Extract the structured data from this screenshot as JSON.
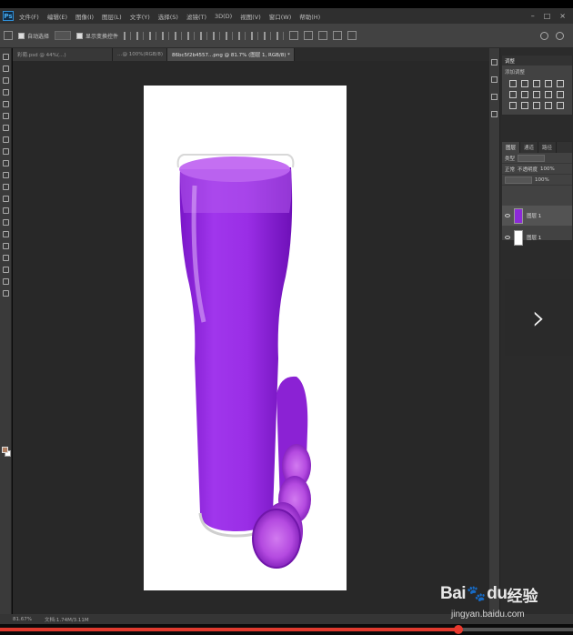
{
  "app": {
    "logo_text": "Ps"
  },
  "menu": {
    "items": [
      "文件(F)",
      "编辑(E)",
      "图像(I)",
      "图层(L)",
      "文字(Y)",
      "选择(S)",
      "滤镜(T)",
      "3D(D)",
      "视图(V)",
      "窗口(W)",
      "帮助(H)"
    ]
  },
  "options": {
    "auto_select_label": "自动选择",
    "show_transform_label": "显示变换控件"
  },
  "tabs": [
    {
      "label": "彩葡.psd @ 44%(…)",
      "active": false
    },
    {
      "label": "…@ 100%(RGB/8)",
      "active": false
    },
    {
      "label": "86bc5f2b4557…png @ 81.7% (图层 1, RGB/8) *",
      "active": true
    }
  ],
  "status": {
    "zoom": "81.67%",
    "doc_size": "文档:1.74M/3.11M"
  },
  "panels": {
    "adjust_tab": "调整",
    "adjust_subtitle": "添加调整",
    "layers_tabs": [
      "图层",
      "通道",
      "路径"
    ],
    "kind_label": "类型",
    "mode_label": "正常",
    "opacity_label": "不透明度",
    "opacity_value": "100%",
    "fill_value": "100%",
    "layers": [
      {
        "name": "图层 1",
        "thumb_color": "#8c2ad8"
      },
      {
        "name": "图层 1",
        "thumb_color": "#ffffff"
      }
    ]
  },
  "next_glyph": "›",
  "watermark": {
    "brand": "Bai",
    "brand2": "du",
    "paw": "🐾",
    "cn": "经验",
    "url": "jingyan.baidu.com"
  },
  "colors": {
    "accent_progress": "#e03a2e",
    "juice": "#9b30e0",
    "foreground_swatch": "#b07f62"
  },
  "video": {
    "progress": 0.8
  }
}
